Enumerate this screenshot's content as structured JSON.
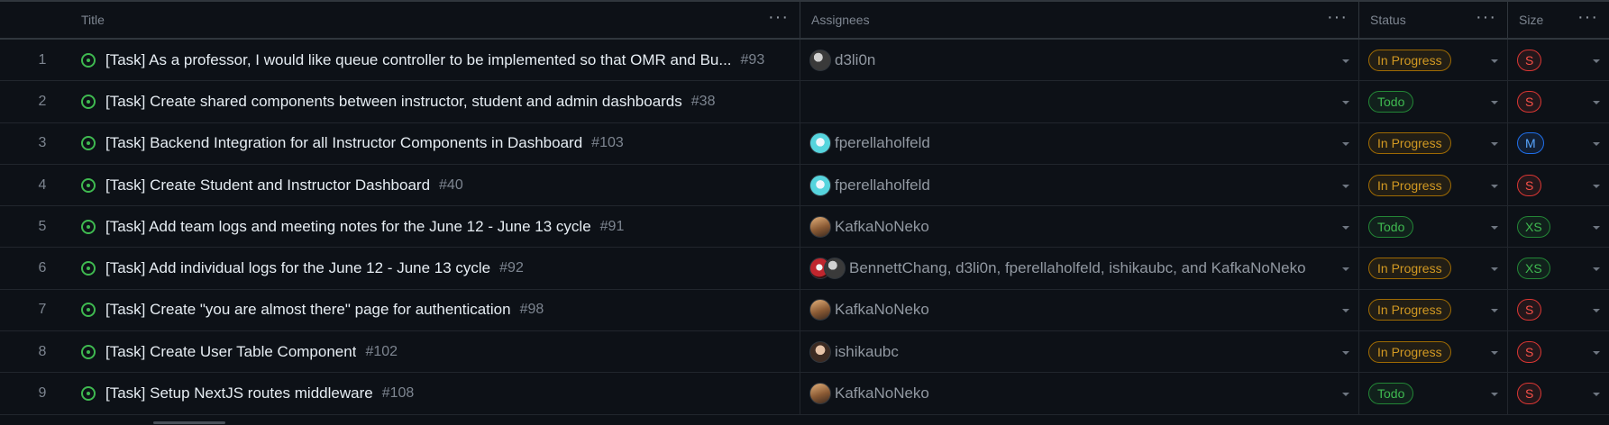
{
  "columns": {
    "title": "Title",
    "assignees": "Assignees",
    "status": "Status",
    "size": "Size",
    "menu_glyph": "···"
  },
  "rows": [
    {
      "index": "1",
      "title": "[Task] As a professor, I would like queue controller to be implemented so that OMR and Bu...",
      "number": "#93",
      "assignees": "d3li0n",
      "avatars": [
        "av-d3"
      ],
      "status": "In Progress",
      "size": "S"
    },
    {
      "index": "2",
      "title": "[Task] Create shared components between instructor, student and admin dashboards",
      "number": "#38",
      "assignees": "",
      "avatars": [],
      "status": "Todo",
      "size": "S"
    },
    {
      "index": "3",
      "title": "[Task] Backend Integration for all Instructor Components in Dashboard",
      "number": "#103",
      "assignees": "fperellaholfeld",
      "avatars": [
        "av-fp"
      ],
      "status": "In Progress",
      "size": "M"
    },
    {
      "index": "4",
      "title": "[Task] Create Student and Instructor Dashboard",
      "number": "#40",
      "assignees": "fperellaholfeld",
      "avatars": [
        "av-fp"
      ],
      "status": "In Progress",
      "size": "S"
    },
    {
      "index": "5",
      "title": "[Task] Add team logs and meeting notes for the June 12 - June 13 cycle",
      "number": "#91",
      "assignees": "KafkaNoNeko",
      "avatars": [
        "av-kk"
      ],
      "status": "Todo",
      "size": "XS"
    },
    {
      "index": "6",
      "title": "[Task] Add individual logs for the June 12 - June 13 cycle",
      "number": "#92",
      "assignees": "BennettChang, d3li0n, fperellaholfeld, ishikaubc, and KafkaNoNeko",
      "avatars": [
        "av-bc",
        "av-d3"
      ],
      "status": "In Progress",
      "size": "XS"
    },
    {
      "index": "7",
      "title": "[Task] Create \"you are almost there\" page for authentication",
      "number": "#98",
      "assignees": "KafkaNoNeko",
      "avatars": [
        "av-kk"
      ],
      "status": "In Progress",
      "size": "S"
    },
    {
      "index": "8",
      "title": "[Task] Create User Table Component",
      "number": "#102",
      "assignees": "ishikaubc",
      "avatars": [
        "av-ik"
      ],
      "status": "In Progress",
      "size": "S"
    },
    {
      "index": "9",
      "title": "[Task] Setup NextJS routes middleware",
      "number": "#108",
      "assignees": "KafkaNoNeko",
      "avatars": [
        "av-kk"
      ],
      "status": "Todo",
      "size": "S"
    }
  ],
  "colors": {
    "background": "#0d1117",
    "in_progress": "#d29922",
    "todo": "#3fb950",
    "size_s": "#f85149",
    "size_m": "#58a6ff",
    "size_xs": "#3fb950"
  }
}
